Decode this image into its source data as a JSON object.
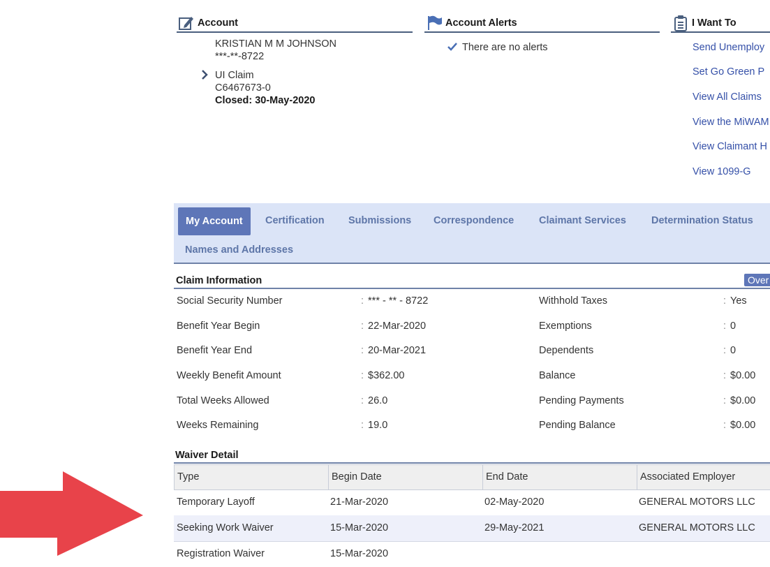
{
  "account": {
    "title": "Account",
    "name": "KRISTIAN M M JOHNSON",
    "ssn": "***-**-8722",
    "claim_type": "UI Claim",
    "claim_id": "C6467673-0",
    "claim_status": "Closed: 30-May-2020"
  },
  "alerts": {
    "title": "Account Alerts",
    "message": "There are no alerts"
  },
  "iwant": {
    "title": "I Want To",
    "links": [
      "Send Unemploy",
      "Set Go Green P",
      "View All Claims",
      "View the MiWAM",
      "View Claimant H",
      "View 1099-G"
    ]
  },
  "tabs": [
    "My Account",
    "Certification",
    "Submissions",
    "Correspondence",
    "Claimant Services",
    "Determination Status",
    "Names and Addresses"
  ],
  "claim_info": {
    "title": "Claim Information",
    "button": "Over",
    "left": [
      {
        "label": "Social Security Number",
        "value": "*** - ** - 8722"
      },
      {
        "label": "Benefit Year Begin",
        "value": "22-Mar-2020"
      },
      {
        "label": "Benefit Year End",
        "value": "20-Mar-2021"
      },
      {
        "label": "Weekly Benefit Amount",
        "value": "$362.00"
      },
      {
        "label": "Total Weeks Allowed",
        "value": "26.0"
      },
      {
        "label": "Weeks Remaining",
        "value": "19.0"
      }
    ],
    "right": [
      {
        "label": "Withhold Taxes",
        "value": "Yes"
      },
      {
        "label": "Exemptions",
        "value": "0"
      },
      {
        "label": "Dependents",
        "value": "0"
      },
      {
        "label": "Balance",
        "value": "$0.00"
      },
      {
        "label": "Pending Payments",
        "value": "$0.00"
      },
      {
        "label": "Pending Balance",
        "value": "$0.00"
      }
    ]
  },
  "waiver": {
    "title": "Waiver Detail",
    "headers": [
      "Type",
      "Begin Date",
      "End Date",
      "Associated Employer"
    ],
    "rows": [
      [
        "Temporary Layoff",
        "21-Mar-2020",
        "02-May-2020",
        "GENERAL MOTORS LLC"
      ],
      [
        "Seeking Work Waiver",
        "15-Mar-2020",
        "29-May-2021",
        "GENERAL MOTORS LLC"
      ],
      [
        "Registration Waiver",
        "15-Mar-2020",
        "",
        ""
      ]
    ]
  },
  "colors": {
    "accent": "#5e76b8",
    "tab_bar": "#dbe4f7",
    "arrow": "#e8434a",
    "link": "#3550a8"
  }
}
